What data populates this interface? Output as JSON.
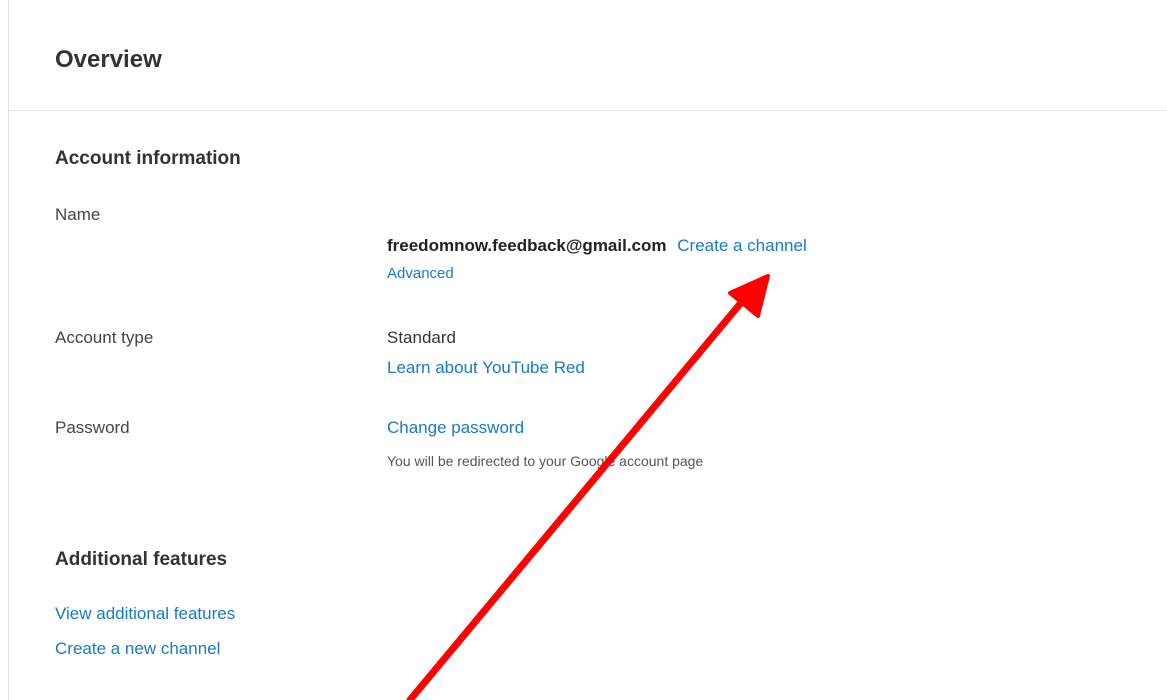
{
  "header": {
    "title": "Overview"
  },
  "account_info": {
    "heading": "Account information",
    "name": {
      "label": "Name",
      "email": "freedomnow.feedback@gmail.com",
      "create_channel_link": "Create a channel",
      "advanced_link": "Advanced"
    },
    "account_type": {
      "label": "Account type",
      "value": "Standard",
      "learn_link": "Learn about YouTube Red"
    },
    "password": {
      "label": "Password",
      "change_link": "Change password",
      "helper": "You will be redirected to your Google account page"
    }
  },
  "additional_features": {
    "heading": "Additional features",
    "view_link": "View additional features",
    "new_channel_link": "Create a new channel"
  },
  "colors": {
    "link": "#167ac6",
    "annotation_arrow": "#ff0000"
  }
}
